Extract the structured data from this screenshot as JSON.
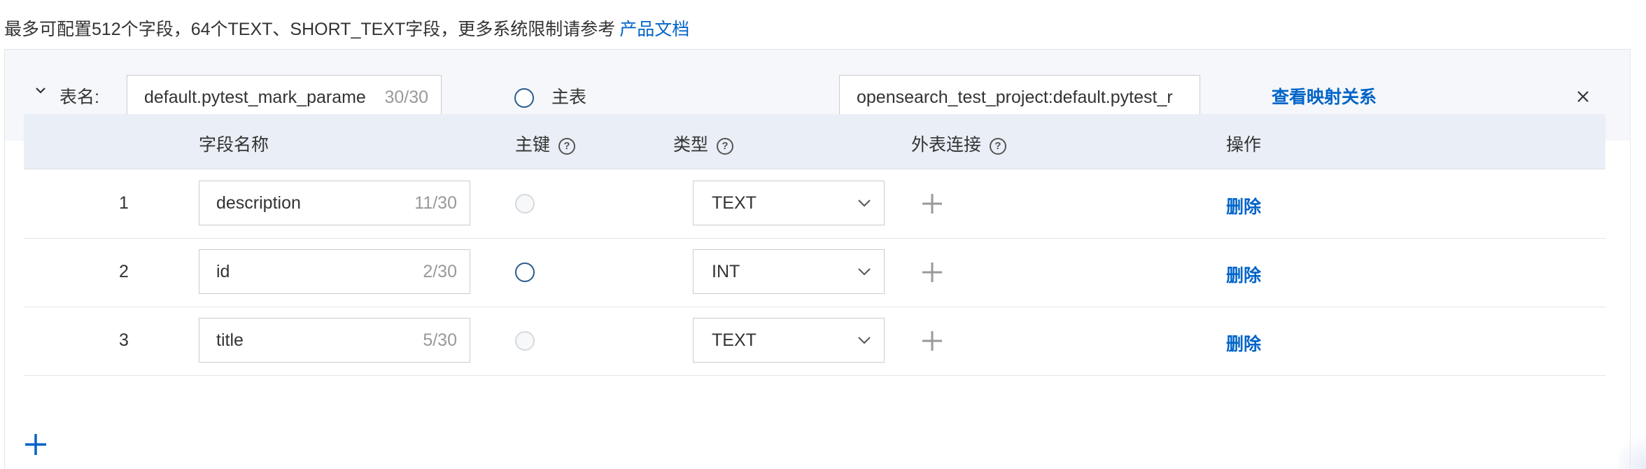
{
  "notice": {
    "text": "最多可配置512个字段，64个TEXT、SHORT_TEXT字段，更多系统限制请参考",
    "link": "产品文档"
  },
  "table_config": {
    "collapse_icon": "chevron-down-icon",
    "table_name_label": "表名:",
    "table_name_value": "default.pytest_mark_parame",
    "table_name_count": "30/30",
    "primary_label": "主表",
    "mapping_value": "opensearch_test_project:default.pytest_r",
    "view_mapping_link": "查看映射关系",
    "close_icon": "close-icon"
  },
  "columns": {
    "field_name": "字段名称",
    "primary_key": "主键",
    "type": "类型",
    "foreign_join": "外表连接",
    "actions": "操作"
  },
  "rows": [
    {
      "index": "1",
      "field": "description",
      "count": "11/30",
      "primary": false,
      "type": "TEXT",
      "delete": "删除"
    },
    {
      "index": "2",
      "field": "id",
      "count": "2/30",
      "primary": true,
      "type": "INT",
      "delete": "删除"
    },
    {
      "index": "3",
      "field": "title",
      "count": "5/30",
      "primary": false,
      "type": "TEXT",
      "delete": "删除"
    }
  ],
  "colors": {
    "link": "#0064c8",
    "header_bg": "#eaeef6",
    "panel_head_bg": "#f5f7fa"
  }
}
